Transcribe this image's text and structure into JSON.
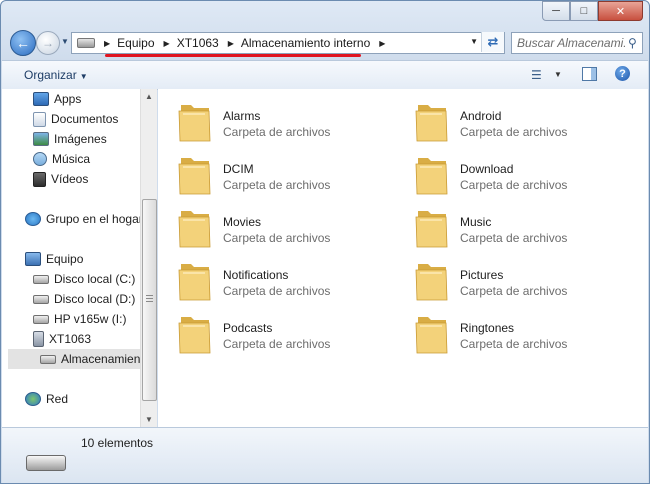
{
  "address": {
    "crumbs": [
      "Equipo",
      "XT1063",
      "Almacenamiento interno"
    ]
  },
  "search": {
    "placeholder": "Buscar Almacenami..."
  },
  "toolbar": {
    "organize_label": "Organizar"
  },
  "nav": {
    "items": [
      {
        "label": "Apps",
        "icon": "apps-icon"
      },
      {
        "label": "Documentos",
        "icon": "documents-icon"
      },
      {
        "label": "Imágenes",
        "icon": "images-icon"
      },
      {
        "label": "Música",
        "icon": "music-icon"
      },
      {
        "label": "Vídeos",
        "icon": "videos-icon"
      },
      {
        "label": "Grupo en el hogar",
        "icon": "homegroup-icon"
      },
      {
        "label": "Equipo",
        "icon": "computer-icon"
      },
      {
        "label": "Disco local (C:)",
        "icon": "drive-icon"
      },
      {
        "label": "Disco local (D:)",
        "icon": "drive-icon"
      },
      {
        "label": "HP v165w (I:)",
        "icon": "usb-drive-icon"
      },
      {
        "label": "XT1063",
        "icon": "phone-icon"
      },
      {
        "label": "Almacenamiento interno",
        "icon": "storage-icon"
      },
      {
        "label": "Red",
        "icon": "network-icon"
      }
    ]
  },
  "folders": [
    {
      "name": "Alarms",
      "type": "Carpeta de archivos"
    },
    {
      "name": "Android",
      "type": "Carpeta de archivos"
    },
    {
      "name": "DCIM",
      "type": "Carpeta de archivos"
    },
    {
      "name": "Download",
      "type": "Carpeta de archivos"
    },
    {
      "name": "Movies",
      "type": "Carpeta de archivos"
    },
    {
      "name": "Music",
      "type": "Carpeta de archivos"
    },
    {
      "name": "Notifications",
      "type": "Carpeta de archivos"
    },
    {
      "name": "Pictures",
      "type": "Carpeta de archivos"
    },
    {
      "name": "Podcasts",
      "type": "Carpeta de archivos"
    },
    {
      "name": "Ringtones",
      "type": "Carpeta de archivos"
    }
  ],
  "details": {
    "count": "10 elementos"
  },
  "colors": {
    "folder": "#f3d27a",
    "folder_dark": "#d9ad45",
    "annotation": "#e0141f"
  }
}
